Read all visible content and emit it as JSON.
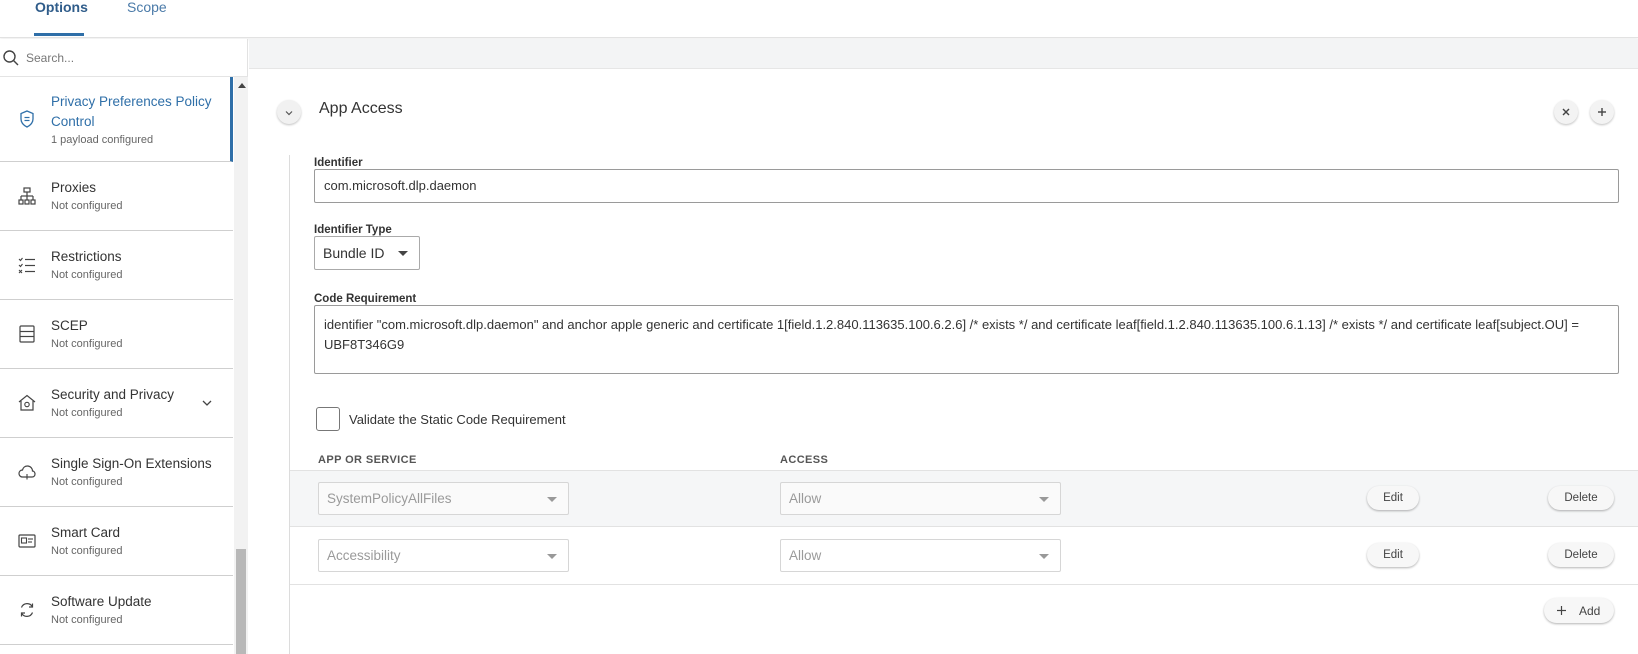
{
  "tabs": {
    "options": "Options",
    "scope": "Scope"
  },
  "search": {
    "placeholder": "Search..."
  },
  "sidebar": {
    "items": [
      {
        "title": "Privacy Preferences Policy Control",
        "status": "1 payload configured",
        "icon": "shield-icon"
      },
      {
        "title": "Proxies",
        "status": "Not configured",
        "icon": "network-icon"
      },
      {
        "title": "Restrictions",
        "status": "Not configured",
        "icon": "checklist-icon"
      },
      {
        "title": "SCEP",
        "status": "Not configured",
        "icon": "server-icon"
      },
      {
        "title": "Security and Privacy",
        "status": "Not configured",
        "icon": "house-icon"
      },
      {
        "title": "Single Sign-On Extensions",
        "status": "Not configured",
        "icon": "cloud-icon"
      },
      {
        "title": "Smart Card",
        "status": "Not configured",
        "icon": "card-icon"
      },
      {
        "title": "Software Update",
        "status": "Not configured",
        "icon": "sync-icon"
      }
    ]
  },
  "section": {
    "title": "App Access",
    "identifier_label": "Identifier",
    "identifier_value": "com.microsoft.dlp.daemon",
    "identifier_type_label": "Identifier Type",
    "identifier_type_value": "Bundle ID",
    "code_requirement_label": "Code Requirement",
    "code_requirement_value": "identifier \"com.microsoft.dlp.daemon\" and anchor apple generic and certificate 1[field.1.2.840.113635.100.6.2.6] /* exists */ and certificate leaf[field.1.2.840.113635.100.6.1.13] /* exists */ and certificate leaf[subject.OU] = UBF8T346G9",
    "validate_label": "Validate the Static Code Requirement"
  },
  "table": {
    "col_app": "APP OR SERVICE",
    "col_access": "ACCESS",
    "rows": [
      {
        "service": "SystemPolicyAllFiles",
        "access": "Allow",
        "edit": "Edit",
        "delete": "Delete"
      },
      {
        "service": "Accessibility",
        "access": "Allow",
        "edit": "Edit",
        "delete": "Delete"
      }
    ],
    "add_label": "Add"
  }
}
